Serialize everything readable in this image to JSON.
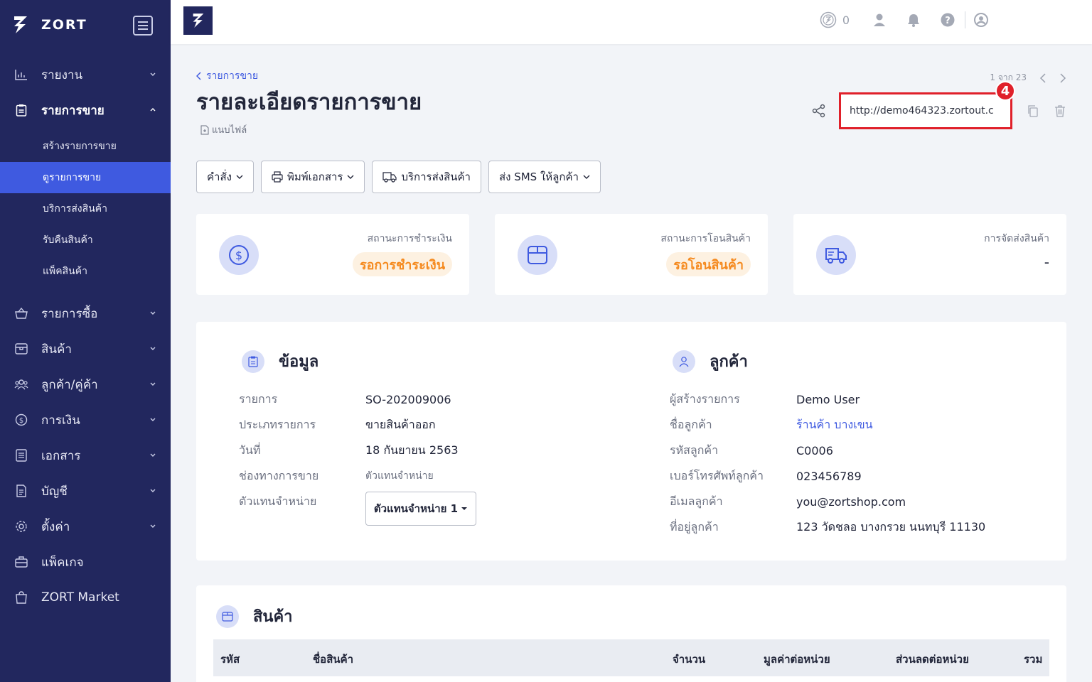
{
  "brand": {
    "name": "ZORT"
  },
  "sidebar": {
    "items": [
      {
        "label": "รายงาน",
        "icon": "bar-chart-icon"
      },
      {
        "label": "รายการขาย",
        "icon": "clipboard-icon",
        "active": true
      },
      {
        "label": "รายการซื้อ",
        "icon": "basket-icon"
      },
      {
        "label": "สินค้า",
        "icon": "box-icon"
      },
      {
        "label": "ลูกค้า/คู่ค้า",
        "icon": "users-icon"
      },
      {
        "label": "การเงิน",
        "icon": "dollar-icon"
      },
      {
        "label": "เอกสาร",
        "icon": "document-icon"
      },
      {
        "label": "บัญชี",
        "icon": "ledger-icon"
      },
      {
        "label": "ตั้งค่า",
        "icon": "gear-icon"
      },
      {
        "label": "แพ็คเกจ",
        "icon": "briefcase-icon"
      },
      {
        "label": "ZORT Market",
        "icon": "shopping-bag-icon"
      }
    ],
    "sub_items": [
      {
        "label": "สร้างรายการขาย"
      },
      {
        "label": "ดูรายการขาย",
        "selected": true
      },
      {
        "label": "บริการส่งสินค้า"
      },
      {
        "label": "รับคืนสินค้า"
      },
      {
        "label": "แพ็คสินค้า"
      }
    ]
  },
  "topbar": {
    "coin_count": "0"
  },
  "page": {
    "breadcrumb": "รายการขาย",
    "title": "รายละเอียดรายการขาย",
    "file_link": "แนบไฟล์",
    "pager": "1 จาก 23",
    "share_url": "http://demo464323.zortout.c",
    "step_badge": "4"
  },
  "buttons": {
    "command": "คำสั่ง",
    "print": "พิมพ์เอกสาร",
    "shipping": "บริการส่งสินค้า",
    "sms": "ส่ง SMS ให้ลูกค้า"
  },
  "status": {
    "payment": {
      "label": "สถานะการชำระเงิน",
      "value": "รอการชำระเงิน"
    },
    "transfer": {
      "label": "สถานะการโอนสินค้า",
      "value": "รอโอนสินค้า"
    },
    "delivery": {
      "label": "การจัดส่งสินค้า",
      "value": "-"
    }
  },
  "info": {
    "title": "ข้อมูล",
    "rows": [
      {
        "k": "รายการ",
        "v": "SO-202009006"
      },
      {
        "k": "ประเภทรายการ",
        "v": "ขายสินค้าออก"
      },
      {
        "k": "วันที่",
        "v": "18 กันยายน 2563"
      },
      {
        "k": "ช่องทางการขาย",
        "v": "ตัวแทนจำหน่าย"
      },
      {
        "k": "ตัวแทนจำหน่าย",
        "v": ""
      }
    ],
    "agent_select": "ตัวแทนจำหน่าย 1"
  },
  "customer": {
    "title": "ลูกค้า",
    "rows": [
      {
        "k": "ผู้สร้างรายการ",
        "v": "Demo User"
      },
      {
        "k": "ชื่อลูกค้า",
        "v": "ร้านค้า บางเขน"
      },
      {
        "k": "รหัสลูกค้า",
        "v": "C0006"
      },
      {
        "k": "เบอร์โทรศัพท์ลูกค้า",
        "v": "023456789"
      },
      {
        "k": "อีเมลลูกค้า",
        "v": "you@zortshop.com"
      },
      {
        "k": "ที่อยู่ลูกค้า",
        "v": "123 วัดชลอ บางกรวย นนทบุรี 11130"
      }
    ]
  },
  "products": {
    "title": "สินค้า",
    "columns": [
      "รหัส",
      "ชื่อสินค้า",
      "จำนวน",
      "มูลค่าต่อหน่วย",
      "ส่วนลดต่อหน่วย",
      "รวม"
    ]
  },
  "colors": {
    "sidebar": "#22275e",
    "accent": "#3f5ae0",
    "warning": "#f58a1f",
    "highlight": "#e0202a"
  }
}
